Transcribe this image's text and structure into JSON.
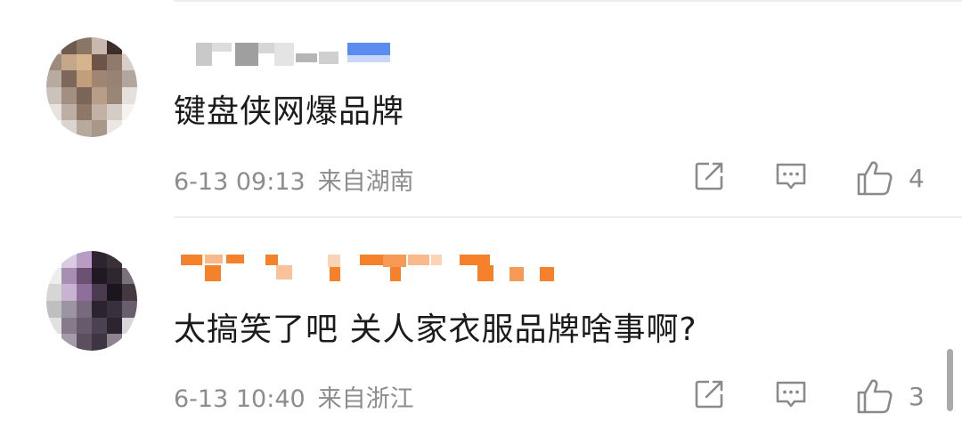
{
  "comments": [
    {
      "text": "键盘侠网爆品牌",
      "time": "6-13 09:13",
      "location": "来自湖南",
      "likes": "4",
      "share_icon": "share-icon",
      "reply_icon": "reply-icon",
      "like_icon": "thumbs-up-icon"
    },
    {
      "text": "太搞笑了吧 关人家衣服品牌啥事啊?",
      "time": "6-13 10:40",
      "location": "来自浙江",
      "likes": "3",
      "share_icon": "share-icon",
      "reply_icon": "reply-icon",
      "like_icon": "thumbs-up-icon"
    }
  ],
  "colors": {
    "text": "#1b1b1b",
    "meta": "#8c8c8c",
    "icon": "#8a8a8a",
    "divider": "#ededed",
    "username_orange": "#f5822a",
    "username_blue": "#5b8cf0"
  }
}
